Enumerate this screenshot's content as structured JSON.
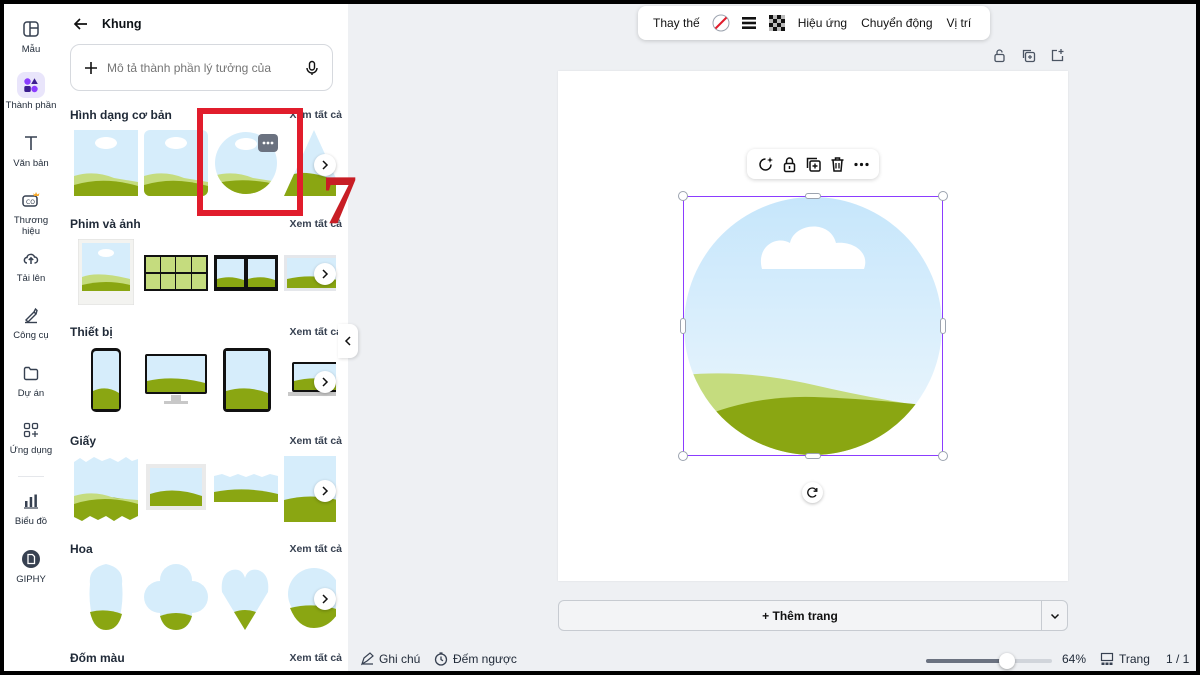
{
  "sidebar": {
    "items": [
      {
        "label": "Mẫu",
        "icon": "template-icon"
      },
      {
        "label": "Thành phần",
        "icon": "elements-icon"
      },
      {
        "label": "Văn bản",
        "icon": "text-icon"
      },
      {
        "label": "Thương hiệu",
        "icon": "brand-icon"
      },
      {
        "label": "Tải lên",
        "icon": "upload-icon"
      },
      {
        "label": "Công cụ",
        "icon": "tools-icon"
      },
      {
        "label": "Dự án",
        "icon": "folder-icon"
      },
      {
        "label": "Ứng dụng",
        "icon": "apps-icon"
      },
      {
        "label": "Biểu đồ",
        "icon": "chart-icon"
      },
      {
        "label": "GIPHY",
        "icon": "giphy-icon"
      }
    ],
    "active_index": 1
  },
  "panel": {
    "title": "Khung",
    "search_placeholder": "Mô tả thành phần lý tưởng của",
    "see_all": "Xem tất cả",
    "sections": [
      {
        "title": "Hình dạng cơ bản"
      },
      {
        "title": "Phim và ảnh"
      },
      {
        "title": "Thiết bị"
      },
      {
        "title": "Giấy"
      },
      {
        "title": "Hoa"
      },
      {
        "title": "Đốm màu"
      }
    ]
  },
  "annotation": {
    "number": "7",
    "color": "#e11d2c"
  },
  "toolbar": {
    "replace": "Thay thế",
    "effects": "Hiệu ứng",
    "animate": "Chuyển động",
    "position": "Vị trí"
  },
  "canvas": {
    "add_page": "+ Thêm trang"
  },
  "bottom_bar": {
    "notes": "Ghi chú",
    "timer": "Đếm ngược",
    "zoom": "64%",
    "zoom_fraction": 0.64,
    "pages_label": "Trang",
    "page_count": "1 / 1"
  },
  "colors": {
    "accent": "#8b3dff",
    "sky": "#cfe9fb",
    "grass_dark": "#8aa612",
    "grass_light": "#c5dc7e",
    "highlight": "#e11d2c"
  }
}
